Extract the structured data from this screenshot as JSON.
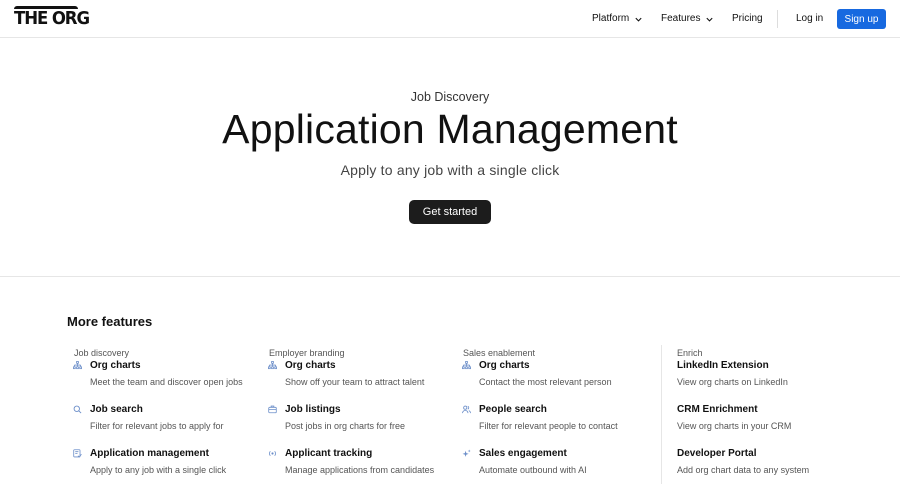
{
  "nav": {
    "logo_text": "THE ORG",
    "items": [
      {
        "label": "Platform",
        "has_dropdown": true
      },
      {
        "label": "Features",
        "has_dropdown": true
      },
      {
        "label": "Pricing",
        "has_dropdown": false
      }
    ],
    "login_label": "Log in",
    "signup_label": "Sign up",
    "accent_color": "#1769e0"
  },
  "hero": {
    "eyebrow": "Job Discovery",
    "title": "Application Management",
    "subtitle": "Apply to any job with a single click",
    "cta_label": "Get started"
  },
  "more_features": {
    "title": "More features",
    "columns": [
      {
        "heading": "Job discovery",
        "items": [
          {
            "icon": "org-chart-icon",
            "title": "Org charts",
            "desc": "Meet the team and discover open jobs"
          },
          {
            "icon": "search-icon",
            "title": "Job search",
            "desc": "Filter for relevant jobs to apply for"
          },
          {
            "icon": "application-icon",
            "title": "Application management",
            "desc": "Apply to any job with a single click"
          }
        ]
      },
      {
        "heading": "Employer branding",
        "items": [
          {
            "icon": "org-chart-icon",
            "title": "Org charts",
            "desc": "Show off your team to attract talent"
          },
          {
            "icon": "briefcase-icon",
            "title": "Job listings",
            "desc": "Post jobs in org charts for free"
          },
          {
            "icon": "tracking-icon",
            "title": "Applicant tracking",
            "desc": "Manage applications from candidates"
          }
        ]
      },
      {
        "heading": "Sales enablement",
        "items": [
          {
            "icon": "org-chart-icon",
            "title": "Org charts",
            "desc": "Contact the most relevant person"
          },
          {
            "icon": "people-icon",
            "title": "People search",
            "desc": "Filter for relevant people to contact"
          },
          {
            "icon": "sparkle-icon",
            "title": "Sales engagement",
            "desc": "Automate outbound with AI"
          }
        ]
      },
      {
        "heading": "Enrich",
        "items": [
          {
            "title": "LinkedIn Extension",
            "desc": "View org charts on LinkedIn"
          },
          {
            "title": "CRM Enrichment",
            "desc": "View org charts in your CRM"
          },
          {
            "title": "Developer Portal",
            "desc": "Add org chart data to any system"
          }
        ]
      }
    ]
  }
}
